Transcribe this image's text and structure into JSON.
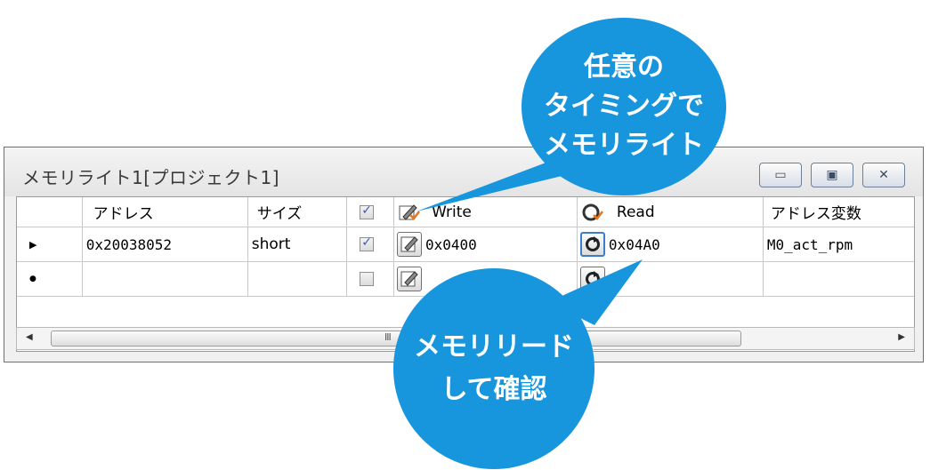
{
  "window": {
    "title": "メモリライト1[プロジェクト1]",
    "controls": {
      "minimize": "▭",
      "restore": "▣",
      "close": "✕"
    }
  },
  "table": {
    "headers": [
      "アドレス",
      "サイズ",
      "",
      "Write",
      "Read",
      "アドレス変数"
    ],
    "rows": [
      {
        "marker": "▶",
        "address": "0x20038052",
        "size": "short",
        "enabled": true,
        "write": "0x0400",
        "read": "0x04A0",
        "variable": "M0_act_rpm"
      },
      {
        "marker": "●",
        "address": "",
        "size": "",
        "enabled": false,
        "write": "",
        "read": "",
        "variable": ""
      }
    ]
  },
  "scrollbar": {
    "left_arrow": "◀",
    "right_arrow": "▶",
    "grip": "III"
  },
  "callouts": {
    "top": [
      "任意の",
      "タイミングで",
      "メモリライト"
    ],
    "bottom": [
      "メモリリード",
      "して確認"
    ]
  },
  "colors": {
    "callout": "#1795dd",
    "accent": "#3c7fc8",
    "checkmark": "#3b5dae"
  },
  "icons": {
    "write": "pencil-icon",
    "read": "refresh-icon"
  }
}
